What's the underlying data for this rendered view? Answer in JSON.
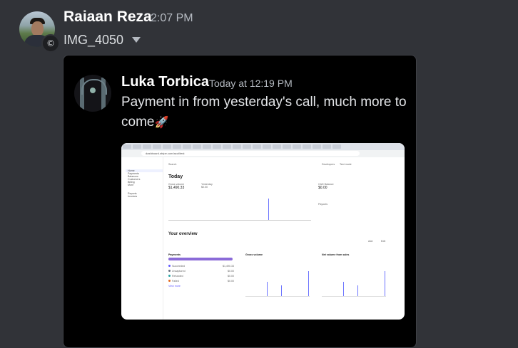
{
  "message": {
    "author": "Raiaan Reza",
    "time": "2:07 PM",
    "attachment_name": "IMG_4050"
  },
  "quoted": {
    "author": "Luka Torbica",
    "time": "Today at 12:19 PM",
    "text": "Payment in from yesterday's call, much more to come",
    "emoji": "🚀"
  },
  "screenshot": {
    "url": "dashboard.stripe.com/acct/test",
    "sidebar": [
      "Home",
      "Payments",
      "Balances",
      "Customers",
      "Billing",
      "More"
    ],
    "sidebar_extra": [
      "Reports",
      "Invoices"
    ],
    "search": "Search",
    "toolbar": [
      "Developers",
      "Test mode"
    ],
    "today_label": "Today",
    "gross_volume_label": "Gross volume",
    "gross_volume_value": "$1,490.33",
    "yesterday_label": "Yesterday",
    "yesterday_value": "$0.00",
    "balance_label": "CAD Balance",
    "balance_value": "$0.00",
    "payouts_label": "Payouts",
    "overview_title": "Your overview",
    "payments_title": "Payments",
    "payment_rows": [
      {
        "label": "Succeeded",
        "value": "$1,490.33",
        "color": "#635bff"
      },
      {
        "label": "Uncaptured",
        "value": "$0.00",
        "color": "#6b7280"
      },
      {
        "label": "Refunded",
        "value": "$0.00",
        "color": "#2aa3a3"
      },
      {
        "label": "Failed",
        "value": "$0.00",
        "color": "#e66a1f"
      }
    ],
    "gross_volume_title": "Gross volume",
    "net_volume_title": "Net volume from sales",
    "add_button": "Add",
    "edit_button": "Edit",
    "view_more": "View more"
  }
}
